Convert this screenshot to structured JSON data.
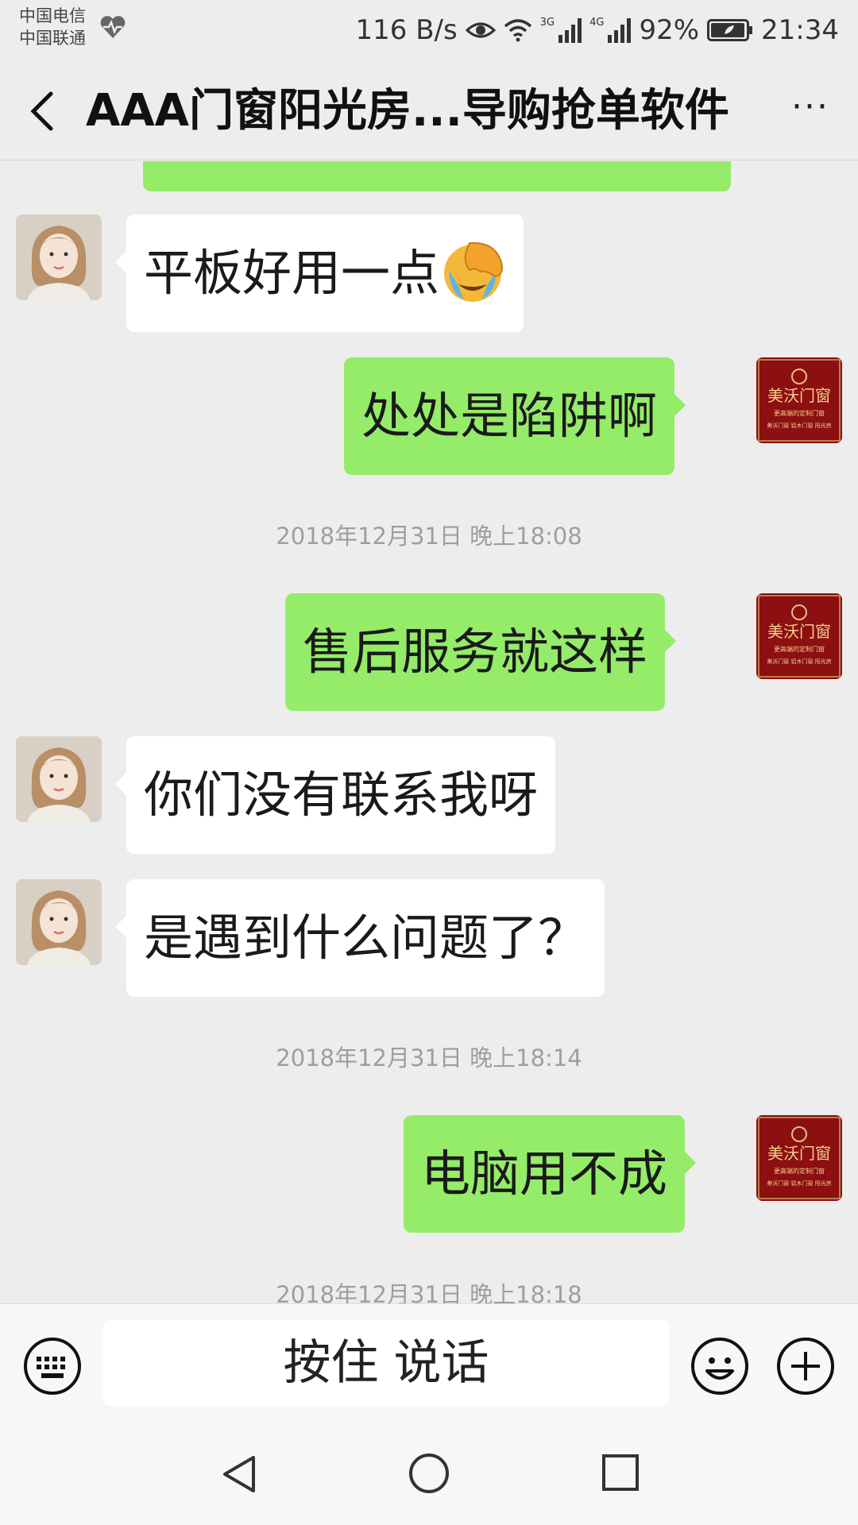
{
  "status_bar": {
    "carrier_1": "中国电信",
    "carrier_2": "中国联通",
    "net_speed": "116 B/s",
    "net_3g": "3G",
    "net_4g": "4G",
    "battery": "92%",
    "time": "21:34"
  },
  "header": {
    "title": "AAA门窗阳光房...导购抢单软件",
    "more_label": "···"
  },
  "messages": [
    {
      "side": "out",
      "text": ""
    },
    {
      "side": "in",
      "text": "平板好用一点",
      "emoji": "face-palm-crying-emoji"
    },
    {
      "side": "out",
      "text": "处处是陷阱啊"
    },
    {
      "type": "time",
      "text": "2018年12月31日 晚上18:08"
    },
    {
      "side": "out",
      "text": "售后服务就这样"
    },
    {
      "side": "in",
      "text": "你们没有联系我呀"
    },
    {
      "side": "in",
      "text": "是遇到什么问题了？"
    },
    {
      "type": "time",
      "text": "2018年12月31日 晚上18:14"
    },
    {
      "side": "out",
      "text": "电脑用不成"
    },
    {
      "type": "time",
      "text": "2018年12月31日 晚上18:18"
    }
  ],
  "brand_avatar": {
    "name": "美沃门窗",
    "tagline": "更高端的定制门窗",
    "subline": "美沃门窗 铝木门窗 阳光房"
  },
  "input_bar": {
    "hold_to_talk": "按住 说话"
  },
  "colors": {
    "background": "#ededed",
    "incoming_bubble": "#ffffff",
    "outgoing_bubble": "#95ec69",
    "timestamp": "#9e9e9e",
    "brand_red": "#8c0f12"
  },
  "icons": [
    "heart-rate-icon",
    "eye-icon",
    "wifi-icon",
    "signal-icon",
    "battery-icon",
    "back-icon",
    "more-icon",
    "keyboard-icon",
    "emoji-icon",
    "plus-icon",
    "nav-back-icon",
    "nav-home-icon",
    "nav-recent-icon"
  ]
}
